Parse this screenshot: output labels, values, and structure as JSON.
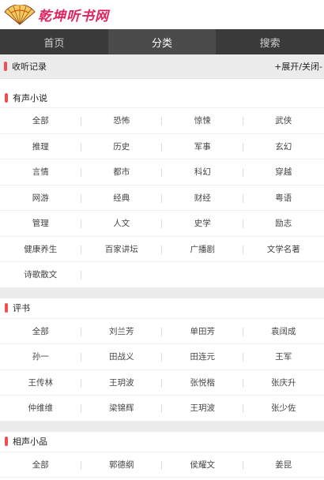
{
  "header": {
    "logo_text": "乾坤听书网"
  },
  "nav": {
    "items": [
      "首页",
      "分类",
      "搜索"
    ],
    "active_index": 1
  },
  "history": {
    "label": "收听记录",
    "toggle": "+展开/关闭-"
  },
  "colors": {
    "accent": "#ef4e55",
    "nav_bg": "#3a3a3a",
    "nav_active": "#4b4b4b",
    "logo": "#e0245e"
  },
  "sections": [
    {
      "title": "有声小说",
      "items": [
        "全部",
        "恐怖",
        "惊悚",
        "武侠",
        "推理",
        "历史",
        "军事",
        "玄幻",
        "言情",
        "都市",
        "科幻",
        "穿越",
        "网游",
        "经典",
        "财经",
        "粤语",
        "管理",
        "人文",
        "史学",
        "励志",
        "健康养生",
        "百家讲坛",
        "广播剧",
        "文学名著",
        "诗歌散文"
      ]
    },
    {
      "title": "评书",
      "items": [
        "全部",
        "刘兰芳",
        "单田芳",
        "袁阔成",
        "孙一",
        "田战义",
        "田连元",
        "王军",
        "王传林",
        "王玥波",
        "张悦楷",
        "张庆升",
        "仲维维",
        "梁锦辉",
        "王玥波",
        "张少佐"
      ]
    },
    {
      "title": "相声小品",
      "items": [
        "全部",
        "郭德纲",
        "侯耀文",
        "姜昆"
      ]
    }
  ]
}
